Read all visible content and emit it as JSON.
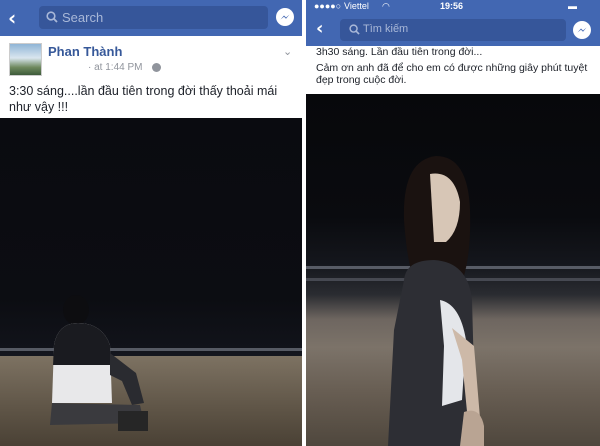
{
  "left_screen": {
    "search": {
      "placeholder": "Search"
    },
    "post": {
      "author": "Phan Thành",
      "time": "at 1:44 PM",
      "visibility_sep": "·",
      "text": "3:30 sáng....lần đầu tiên trong đời thấy thoải mái như vậy !!!"
    }
  },
  "right_screen": {
    "status": {
      "carrier": "Viettel",
      "clock": "19:56"
    },
    "search": {
      "placeholder": "Tìm kiếm"
    },
    "post": {
      "text_line1": "3h30 sáng. Lần đầu tiên trong đời...",
      "text_line2": "Cảm ơn anh đã để cho em có được những giây phút tuyệt đẹp trong cuộc đời."
    }
  },
  "colors": {
    "facebook_blue": "#4267b2",
    "search_field": "#36569a",
    "author_link": "#365899"
  },
  "icons": [
    "back-icon",
    "search-icon",
    "messenger-icon",
    "globe-icon",
    "chevron-down-icon",
    "wifi-icon",
    "battery-icon"
  ]
}
